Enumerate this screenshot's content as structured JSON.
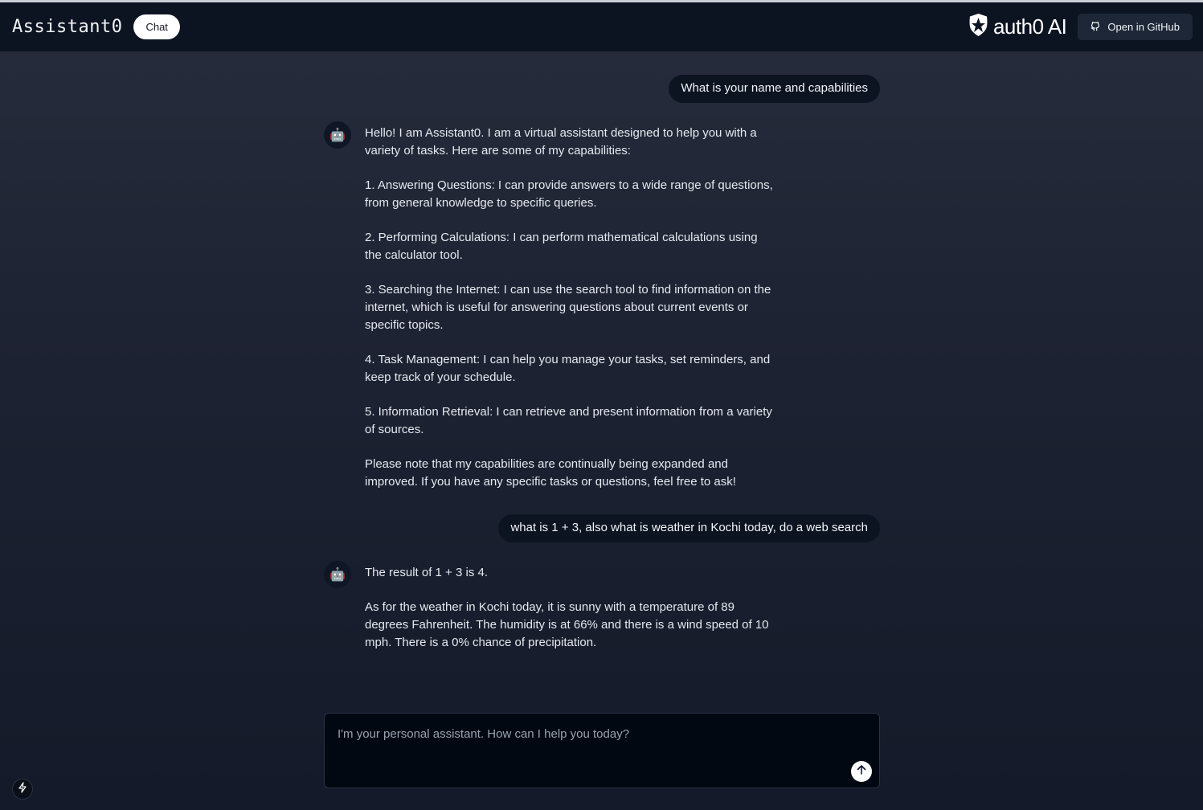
{
  "header": {
    "app_title": "Assistant0",
    "nav_chat_label": "Chat",
    "brand_text": "auth0 AI",
    "github_label": "Open in GitHub"
  },
  "icons": {
    "brand": "auth0-shield-icon",
    "github": "github-icon",
    "avatar": "robot-icon",
    "send": "arrow-up-icon",
    "dev": "lightning-bolt-icon"
  },
  "messages": [
    {
      "role": "user",
      "text": "What is your name and capabilities"
    },
    {
      "role": "assistant",
      "avatar": "🤖",
      "paragraphs": [
        "Hello! I am Assistant0. I am a virtual assistant designed to help you with a variety of tasks. Here are some of my capabilities:",
        "1. Answering Questions: I can provide answers to a wide range of questions, from general knowledge to specific queries.",
        "2. Performing Calculations: I can perform mathematical calculations using the calculator tool.",
        "3. Searching the Internet: I can use the search tool to find information on the internet, which is useful for answering questions about current events or specific topics.",
        "4. Task Management: I can help you manage your tasks, set reminders, and keep track of your schedule.",
        "5. Information Retrieval: I can retrieve and present information from a variety of sources.",
        "Please note that my capabilities are continually being expanded and improved. If you have any specific tasks or questions, feel free to ask!"
      ]
    },
    {
      "role": "user",
      "text": "what is 1 + 3, also what is weather in Kochi today, do a web search"
    },
    {
      "role": "assistant",
      "avatar": "🤖",
      "paragraphs": [
        "The result of 1 + 3 is 4.",
        "As for the weather in Kochi today, it is sunny with a temperature of 89 degrees Fahrenheit. The humidity is at 66% and there is a wind speed of 10 mph. There is a 0% chance of precipitation."
      ]
    }
  ],
  "composer": {
    "placeholder": "I'm your personal assistant. How can I help you today?",
    "value": ""
  },
  "colors": {
    "header_bg": "#0c1422",
    "bubble_bg": "#0c1422",
    "page_bg_top": "#272d3c",
    "page_bg_bottom": "#141a29",
    "composer_bg": "#020811"
  }
}
